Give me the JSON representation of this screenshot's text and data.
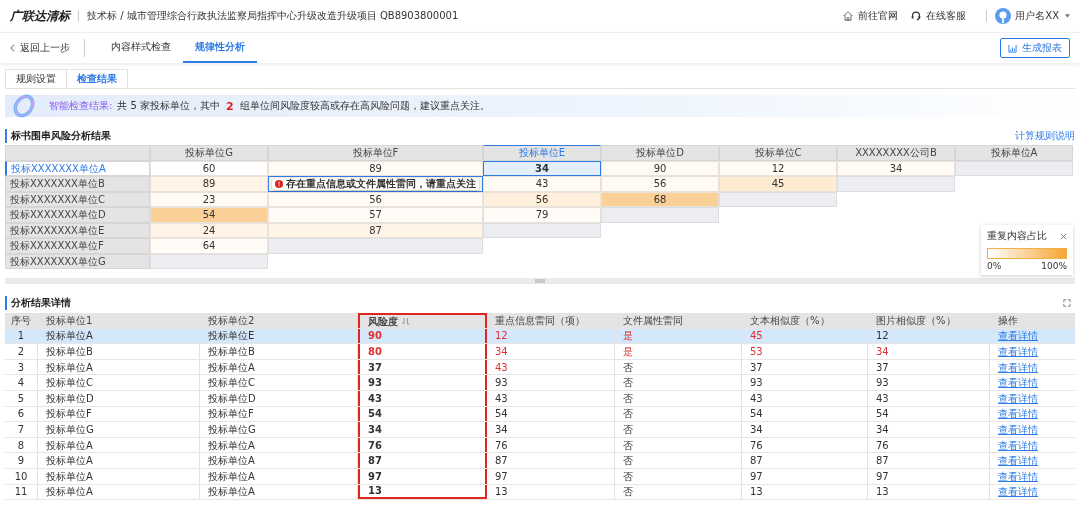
{
  "header": {
    "logo": "广联达清标",
    "breadcrumb": "技术标 / 城市管理综合行政执法监察局指挥中心升级改造升级项目 QB8903800001",
    "links": [
      {
        "kind": "home",
        "label": "前往官网"
      },
      {
        "kind": "support",
        "label": "在线客服"
      }
    ],
    "user": "用户名XX"
  },
  "nav": {
    "back": "返回上一步",
    "tabs": [
      {
        "label": "内容样式检查",
        "selected": false
      },
      {
        "label": "规律性分析",
        "selected": true
      }
    ],
    "action": "生成报表"
  },
  "subtabs": [
    {
      "label": "规则设置",
      "selected": false
    },
    {
      "label": "检查结果",
      "selected": true
    }
  ],
  "banner": {
    "title": "智能检查结果:",
    "text_before": "共 5 家投标单位，其中",
    "count": "2",
    "text_after": "组单位间风险度较高或存在高风险问题，建议重点关注。"
  },
  "matrix": {
    "title": "标书围串风险分析结果",
    "link": "计算规则说明",
    "columns": [
      {
        "label": "投标单位G",
        "selected": false
      },
      {
        "label": "投标单位F",
        "selected": false
      },
      {
        "label": "投标单位E",
        "selected": true
      },
      {
        "label": "投标单位D",
        "selected": false
      },
      {
        "label": "投标单位C",
        "selected": false
      },
      {
        "label": "XXXXXXXX公司B",
        "selected": false
      },
      {
        "label": "投标单位A",
        "selected": false
      }
    ],
    "rows": [
      {
        "label": "投标XXXXXXX单位A",
        "selected": true,
        "cells": [
          {
            "value": "60",
            "color": "#ffffff",
            "selected": false
          },
          {
            "value": "89",
            "color": "#fffaf3",
            "selected": false
          },
          {
            "value": "34",
            "color": "#e3eefb",
            "selected": true
          },
          {
            "value": "90",
            "color": "#fffaf3",
            "selected": false
          },
          {
            "value": "12",
            "color": "#fffaf3",
            "selected": false
          },
          {
            "value": "34",
            "color": "#fffaf3",
            "selected": false
          }
        ]
      },
      {
        "label": "投标XXXXXXX单位B",
        "selected": false,
        "cells": [
          {
            "value": "89",
            "color": "#fff4e6",
            "selected": false
          },
          {
            "kind": "tooltip",
            "color": "#fff4e6",
            "selected": true
          },
          {
            "value": "43",
            "color": "#fffaf3",
            "selected": false
          },
          {
            "value": "56",
            "color": "#fffaf3",
            "selected": false
          },
          {
            "value": "45",
            "color": "#fdebd2",
            "selected": false
          }
        ]
      },
      {
        "label": "投标XXXXXXX单位C",
        "selected": false,
        "cells": [
          {
            "value": "23",
            "color": "#fffaf3",
            "selected": false
          },
          {
            "value": "56",
            "color": "#fffaf3",
            "selected": false
          },
          {
            "value": "56",
            "color": "#fff0dd",
            "selected": false
          },
          {
            "value": "68",
            "color": "#fbd096",
            "selected": false
          }
        ]
      },
      {
        "label": "投标XXXXXXX单位D",
        "selected": false,
        "cells": [
          {
            "value": "54",
            "color": "#fbd096",
            "selected": false
          },
          {
            "value": "57",
            "color": "#fffcf8",
            "selected": false
          },
          {
            "value": "79",
            "color": "#fffcf8",
            "selected": false
          }
        ]
      },
      {
        "label": "投标XXXXXXX单位E",
        "selected": false,
        "cells": [
          {
            "value": "24",
            "color": "#fff4e6",
            "selected": false
          },
          {
            "value": "87",
            "color": "#fff4e6",
            "selected": false
          }
        ]
      },
      {
        "label": "投标XXXXXXX单位F",
        "selected": false,
        "cells": [
          {
            "value": "64",
            "color": "#fffcf8",
            "selected": false
          }
        ]
      },
      {
        "label": "投标XXXXXXX单位G",
        "selected": false,
        "cells": []
      }
    ],
    "tooltip": "存在重点信息或文件属性雷同，请重点关注",
    "legend": {
      "title": "重复内容占比",
      "min": "0%",
      "max": "100%"
    }
  },
  "details": {
    "title": "分析结果详情",
    "columns": [
      {
        "label": "序号",
        "highlighted": false
      },
      {
        "label": "投标单位1",
        "highlighted": false
      },
      {
        "label": "投标单位2",
        "highlighted": false
      },
      {
        "label": "风险度",
        "highlighted": true
      },
      {
        "label": "重点信息雷同（项）",
        "highlighted": false
      },
      {
        "label": "文件属性雷同",
        "highlighted": false
      },
      {
        "label": "文本相似度（%）",
        "highlighted": false
      },
      {
        "label": "图片相似度（%）",
        "highlighted": false
      },
      {
        "label": "操作",
        "highlighted": false
      }
    ],
    "rows": [
      {
        "selected": true,
        "cells": [
          {
            "text": "1",
            "alert": false
          },
          {
            "text": "投标单位A",
            "alert": false
          },
          {
            "text": "投标单位E",
            "alert": false
          },
          {
            "text": "90",
            "alert": true
          },
          {
            "text": "12",
            "alert": true
          },
          {
            "text": "是",
            "alert": true
          },
          {
            "text": "45",
            "alert": true
          },
          {
            "text": "12",
            "alert": false
          },
          {
            "text": "查看详情",
            "alert": false
          }
        ]
      },
      {
        "selected": false,
        "cells": [
          {
            "text": "2",
            "alert": false
          },
          {
            "text": "投标单位B",
            "alert": false
          },
          {
            "text": "投标单位B",
            "alert": false
          },
          {
            "text": "80",
            "alert": true
          },
          {
            "text": "34",
            "alert": true
          },
          {
            "text": "是",
            "alert": true
          },
          {
            "text": "53",
            "alert": true
          },
          {
            "text": "34",
            "alert": true
          },
          {
            "text": "查看详情",
            "alert": false
          }
        ]
      },
      {
        "selected": false,
        "cells": [
          {
            "text": "3",
            "alert": false
          },
          {
            "text": "投标单位A",
            "alert": false
          },
          {
            "text": "投标单位A",
            "alert": false
          },
          {
            "text": "37",
            "alert": false
          },
          {
            "text": "43",
            "alert": true
          },
          {
            "text": "否",
            "alert": false
          },
          {
            "text": "37",
            "alert": false
          },
          {
            "text": "37",
            "alert": false
          },
          {
            "text": "查看详情",
            "alert": false
          }
        ]
      },
      {
        "selected": false,
        "cells": [
          {
            "text": "4",
            "alert": false
          },
          {
            "text": "投标单位C",
            "alert": false
          },
          {
            "text": "投标单位C",
            "alert": false
          },
          {
            "text": "93",
            "alert": false
          },
          {
            "text": "93",
            "alert": false
          },
          {
            "text": "否",
            "alert": false
          },
          {
            "text": "93",
            "alert": false
          },
          {
            "text": "93",
            "alert": false
          },
          {
            "text": "查看详情",
            "alert": false
          }
        ]
      },
      {
        "selected": false,
        "cells": [
          {
            "text": "5",
            "alert": false
          },
          {
            "text": "投标单位D",
            "alert": false
          },
          {
            "text": "投标单位D",
            "alert": false
          },
          {
            "text": "43",
            "alert": false
          },
          {
            "text": "43",
            "alert": false
          },
          {
            "text": "否",
            "alert": false
          },
          {
            "text": "43",
            "alert": false
          },
          {
            "text": "43",
            "alert": false
          },
          {
            "text": "查看详情",
            "alert": false
          }
        ]
      },
      {
        "selected": false,
        "cells": [
          {
            "text": "6",
            "alert": false
          },
          {
            "text": "投标单位F",
            "alert": false
          },
          {
            "text": "投标单位F",
            "alert": false
          },
          {
            "text": "54",
            "alert": false
          },
          {
            "text": "54",
            "alert": false
          },
          {
            "text": "否",
            "alert": false
          },
          {
            "text": "54",
            "alert": false
          },
          {
            "text": "54",
            "alert": false
          },
          {
            "text": "查看详情",
            "alert": false
          }
        ]
      },
      {
        "selected": false,
        "cells": [
          {
            "text": "7",
            "alert": false
          },
          {
            "text": "投标单位G",
            "alert": false
          },
          {
            "text": "投标单位G",
            "alert": false
          },
          {
            "text": "34",
            "alert": false
          },
          {
            "text": "34",
            "alert": false
          },
          {
            "text": "否",
            "alert": false
          },
          {
            "text": "34",
            "alert": false
          },
          {
            "text": "34",
            "alert": false
          },
          {
            "text": "查看详情",
            "alert": false
          }
        ]
      },
      {
        "selected": false,
        "cells": [
          {
            "text": "8",
            "alert": false
          },
          {
            "text": "投标单位A",
            "alert": false
          },
          {
            "text": "投标单位A",
            "alert": false
          },
          {
            "text": "76",
            "alert": false
          },
          {
            "text": "76",
            "alert": false
          },
          {
            "text": "否",
            "alert": false
          },
          {
            "text": "76",
            "alert": false
          },
          {
            "text": "76",
            "alert": false
          },
          {
            "text": "查看详情",
            "alert": false
          }
        ]
      },
      {
        "selected": false,
        "cells": [
          {
            "text": "9",
            "alert": false
          },
          {
            "text": "投标单位A",
            "alert": false
          },
          {
            "text": "投标单位A",
            "alert": false
          },
          {
            "text": "87",
            "alert": false
          },
          {
            "text": "87",
            "alert": false
          },
          {
            "text": "否",
            "alert": false
          },
          {
            "text": "87",
            "alert": false
          },
          {
            "text": "87",
            "alert": false
          },
          {
            "text": "查看详情",
            "alert": false
          }
        ]
      },
      {
        "selected": false,
        "cells": [
          {
            "text": "10",
            "alert": false
          },
          {
            "text": "投标单位A",
            "alert": false
          },
          {
            "text": "投标单位A",
            "alert": false
          },
          {
            "text": "97",
            "alert": false
          },
          {
            "text": "97",
            "alert": false
          },
          {
            "text": "否",
            "alert": false
          },
          {
            "text": "97",
            "alert": false
          },
          {
            "text": "97",
            "alert": false
          },
          {
            "text": "查看详情",
            "alert": false
          }
        ]
      },
      {
        "selected": false,
        "cells": [
          {
            "text": "11",
            "alert": false
          },
          {
            "text": "投标单位A",
            "alert": false
          },
          {
            "text": "投标单位A",
            "alert": false
          },
          {
            "text": "13",
            "alert": false
          },
          {
            "text": "13",
            "alert": false
          },
          {
            "text": "否",
            "alert": false
          },
          {
            "text": "13",
            "alert": false
          },
          {
            "text": "13",
            "alert": false
          },
          {
            "text": "查看详情",
            "alert": false
          }
        ]
      }
    ]
  }
}
